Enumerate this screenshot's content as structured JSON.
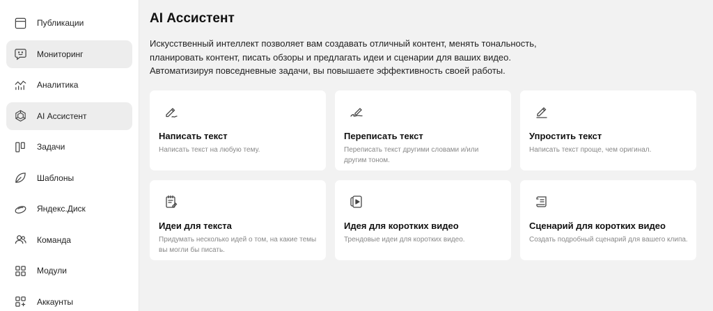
{
  "sidebar": {
    "items": [
      {
        "label": "Публикации",
        "icon": "window-icon",
        "active": false
      },
      {
        "label": "Мониторинг",
        "icon": "chat-bubble-icon",
        "active": true
      },
      {
        "label": "Аналитика",
        "icon": "analytics-icon",
        "active": false
      },
      {
        "label": "AI Ассистент",
        "icon": "ai-hexagon-icon",
        "active": true
      },
      {
        "label": "Задачи",
        "icon": "kanban-icon",
        "active": false
      },
      {
        "label": "Шаблоны",
        "icon": "leaf-icon",
        "active": false
      },
      {
        "label": "Яндекс.Диск",
        "icon": "disk-icon",
        "active": false
      },
      {
        "label": "Команда",
        "icon": "team-icon",
        "active": false
      },
      {
        "label": "Модули",
        "icon": "modules-icon",
        "active": false
      },
      {
        "label": "Аккаунты",
        "icon": "accounts-icon",
        "active": false
      }
    ]
  },
  "main": {
    "title": "AI Ассистент",
    "description": [
      "Искусственный интеллект позволяет вам создавать отличный контент, менять тональность,",
      "планировать контент, писать обзоры и предлагать идеи и сценарии для ваших видео.",
      "Автоматизируя повседневные задачи, вы повышаете эффективность своей работы."
    ],
    "cards": [
      {
        "title": "Написать текст",
        "subtitle": "Написать текст на любую тему.",
        "icon": "pen-write-icon"
      },
      {
        "title": "Переписать текст",
        "subtitle": "Переписать текст другими словами и/или другим тоном.",
        "icon": "rewrite-icon"
      },
      {
        "title": "Упростить текст",
        "subtitle": "Написать текст проще, чем оригинал.",
        "icon": "pencil-icon"
      },
      {
        "title": "Идеи для текста",
        "subtitle": "Придумать несколько идей о том, на какие темы вы могли бы писать.",
        "icon": "notepad-icon"
      },
      {
        "title": "Идея для коротких видео",
        "subtitle": "Трендовые идеи для коротких видео.",
        "icon": "video-icon"
      },
      {
        "title": "Сценарий для коротких видео",
        "subtitle": "Создать подробный сценарий для вашего клипа.",
        "icon": "scroll-icon"
      }
    ]
  }
}
